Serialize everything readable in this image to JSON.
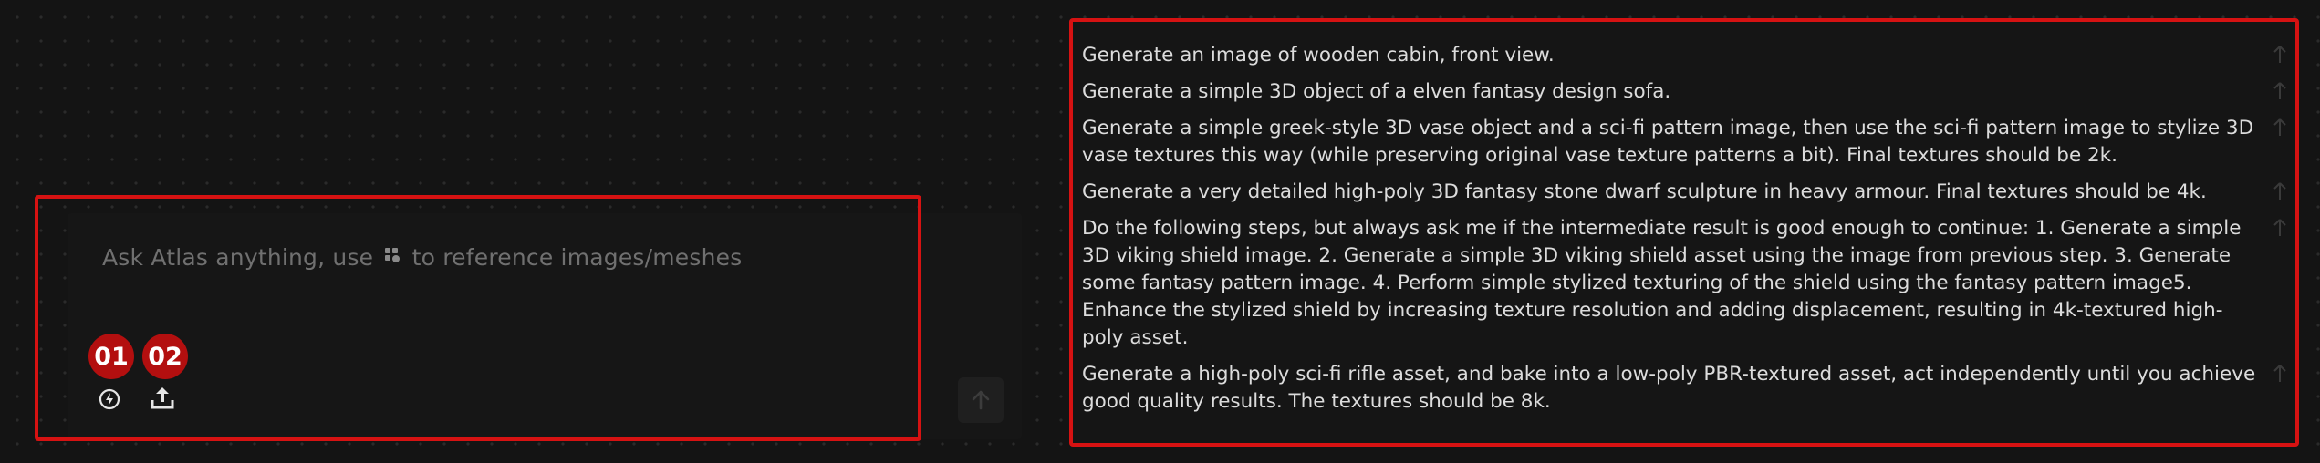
{
  "composer": {
    "placeholder_before": "Ask Atlas anything, use",
    "placeholder_after": "to reference images/meshes",
    "badges": [
      "01",
      "02"
    ],
    "tools": [
      {
        "icon": "generate-icon"
      },
      {
        "icon": "upload-icon"
      }
    ],
    "send_icon": "arrow-up-icon"
  },
  "suggestions": [
    "Generate an image of wooden cabin, front view.",
    "Generate a simple 3D object of a elven fantasy design sofa.",
    "Generate a simple greek-style 3D vase object and a sci-fi pattern image, then use the sci-fi pattern image to stylize 3D vase textures this way (while preserving original vase texture patterns a bit). Final textures should be 2k.",
    "Generate a very detailed high-poly 3D fantasy stone dwarf sculpture in heavy armour. Final textures should be 4k.",
    "Do the following steps, but always ask me if the intermediate result is good enough to continue: 1. Generate a simple 3D viking shield image. 2. Generate a simple 3D viking shield asset using the image from previous step. 3. Generate some fantasy pattern image. 4. Perform simple stylized texturing of the shield using the fantasy pattern image5. Enhance the stylized shield by increasing texture resolution and adding displacement, resulting in 4k-textured high-poly asset.",
    "Generate a high-poly sci-fi rifle asset, and bake into a low-poly PBR-textured asset, act independently until you achieve good quality results. The textures should be 8k."
  ],
  "colors": {
    "background": "#141414",
    "highlight": "#d61212",
    "badge": "#b30f0f",
    "text": "#dcdcdc",
    "placeholder": "#707070"
  }
}
